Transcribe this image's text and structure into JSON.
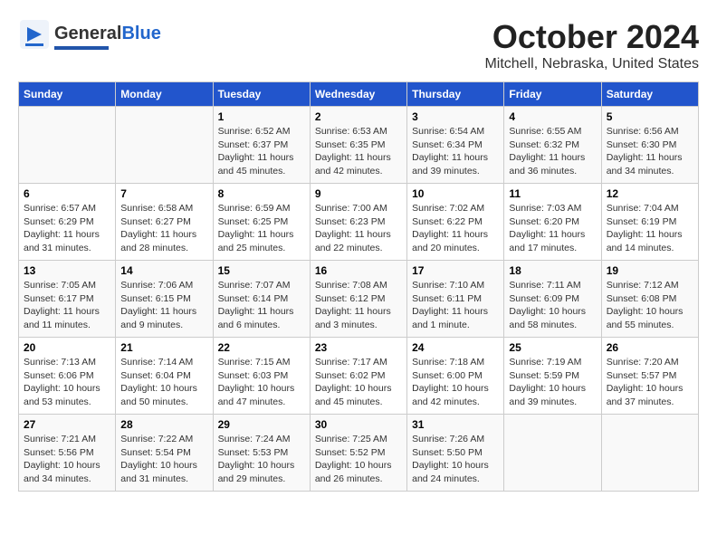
{
  "header": {
    "logo_general": "General",
    "logo_blue": "Blue",
    "title": "October 2024",
    "subtitle": "Mitchell, Nebraska, United States"
  },
  "columns": [
    "Sunday",
    "Monday",
    "Tuesday",
    "Wednesday",
    "Thursday",
    "Friday",
    "Saturday"
  ],
  "weeks": [
    [
      {
        "day": "",
        "info": ""
      },
      {
        "day": "",
        "info": ""
      },
      {
        "day": "1",
        "info": "Sunrise: 6:52 AM\nSunset: 6:37 PM\nDaylight: 11 hours\nand 45 minutes."
      },
      {
        "day": "2",
        "info": "Sunrise: 6:53 AM\nSunset: 6:35 PM\nDaylight: 11 hours\nand 42 minutes."
      },
      {
        "day": "3",
        "info": "Sunrise: 6:54 AM\nSunset: 6:34 PM\nDaylight: 11 hours\nand 39 minutes."
      },
      {
        "day": "4",
        "info": "Sunrise: 6:55 AM\nSunset: 6:32 PM\nDaylight: 11 hours\nand 36 minutes."
      },
      {
        "day": "5",
        "info": "Sunrise: 6:56 AM\nSunset: 6:30 PM\nDaylight: 11 hours\nand 34 minutes."
      }
    ],
    [
      {
        "day": "6",
        "info": "Sunrise: 6:57 AM\nSunset: 6:29 PM\nDaylight: 11 hours\nand 31 minutes."
      },
      {
        "day": "7",
        "info": "Sunrise: 6:58 AM\nSunset: 6:27 PM\nDaylight: 11 hours\nand 28 minutes."
      },
      {
        "day": "8",
        "info": "Sunrise: 6:59 AM\nSunset: 6:25 PM\nDaylight: 11 hours\nand 25 minutes."
      },
      {
        "day": "9",
        "info": "Sunrise: 7:00 AM\nSunset: 6:23 PM\nDaylight: 11 hours\nand 22 minutes."
      },
      {
        "day": "10",
        "info": "Sunrise: 7:02 AM\nSunset: 6:22 PM\nDaylight: 11 hours\nand 20 minutes."
      },
      {
        "day": "11",
        "info": "Sunrise: 7:03 AM\nSunset: 6:20 PM\nDaylight: 11 hours\nand 17 minutes."
      },
      {
        "day": "12",
        "info": "Sunrise: 7:04 AM\nSunset: 6:19 PM\nDaylight: 11 hours\nand 14 minutes."
      }
    ],
    [
      {
        "day": "13",
        "info": "Sunrise: 7:05 AM\nSunset: 6:17 PM\nDaylight: 11 hours\nand 11 minutes."
      },
      {
        "day": "14",
        "info": "Sunrise: 7:06 AM\nSunset: 6:15 PM\nDaylight: 11 hours\nand 9 minutes."
      },
      {
        "day": "15",
        "info": "Sunrise: 7:07 AM\nSunset: 6:14 PM\nDaylight: 11 hours\nand 6 minutes."
      },
      {
        "day": "16",
        "info": "Sunrise: 7:08 AM\nSunset: 6:12 PM\nDaylight: 11 hours\nand 3 minutes."
      },
      {
        "day": "17",
        "info": "Sunrise: 7:10 AM\nSunset: 6:11 PM\nDaylight: 11 hours\nand 1 minute."
      },
      {
        "day": "18",
        "info": "Sunrise: 7:11 AM\nSunset: 6:09 PM\nDaylight: 10 hours\nand 58 minutes."
      },
      {
        "day": "19",
        "info": "Sunrise: 7:12 AM\nSunset: 6:08 PM\nDaylight: 10 hours\nand 55 minutes."
      }
    ],
    [
      {
        "day": "20",
        "info": "Sunrise: 7:13 AM\nSunset: 6:06 PM\nDaylight: 10 hours\nand 53 minutes."
      },
      {
        "day": "21",
        "info": "Sunrise: 7:14 AM\nSunset: 6:04 PM\nDaylight: 10 hours\nand 50 minutes."
      },
      {
        "day": "22",
        "info": "Sunrise: 7:15 AM\nSunset: 6:03 PM\nDaylight: 10 hours\nand 47 minutes."
      },
      {
        "day": "23",
        "info": "Sunrise: 7:17 AM\nSunset: 6:02 PM\nDaylight: 10 hours\nand 45 minutes."
      },
      {
        "day": "24",
        "info": "Sunrise: 7:18 AM\nSunset: 6:00 PM\nDaylight: 10 hours\nand 42 minutes."
      },
      {
        "day": "25",
        "info": "Sunrise: 7:19 AM\nSunset: 5:59 PM\nDaylight: 10 hours\nand 39 minutes."
      },
      {
        "day": "26",
        "info": "Sunrise: 7:20 AM\nSunset: 5:57 PM\nDaylight: 10 hours\nand 37 minutes."
      }
    ],
    [
      {
        "day": "27",
        "info": "Sunrise: 7:21 AM\nSunset: 5:56 PM\nDaylight: 10 hours\nand 34 minutes."
      },
      {
        "day": "28",
        "info": "Sunrise: 7:22 AM\nSunset: 5:54 PM\nDaylight: 10 hours\nand 31 minutes."
      },
      {
        "day": "29",
        "info": "Sunrise: 7:24 AM\nSunset: 5:53 PM\nDaylight: 10 hours\nand 29 minutes."
      },
      {
        "day": "30",
        "info": "Sunrise: 7:25 AM\nSunset: 5:52 PM\nDaylight: 10 hours\nand 26 minutes."
      },
      {
        "day": "31",
        "info": "Sunrise: 7:26 AM\nSunset: 5:50 PM\nDaylight: 10 hours\nand 24 minutes."
      },
      {
        "day": "",
        "info": ""
      },
      {
        "day": "",
        "info": ""
      }
    ]
  ]
}
